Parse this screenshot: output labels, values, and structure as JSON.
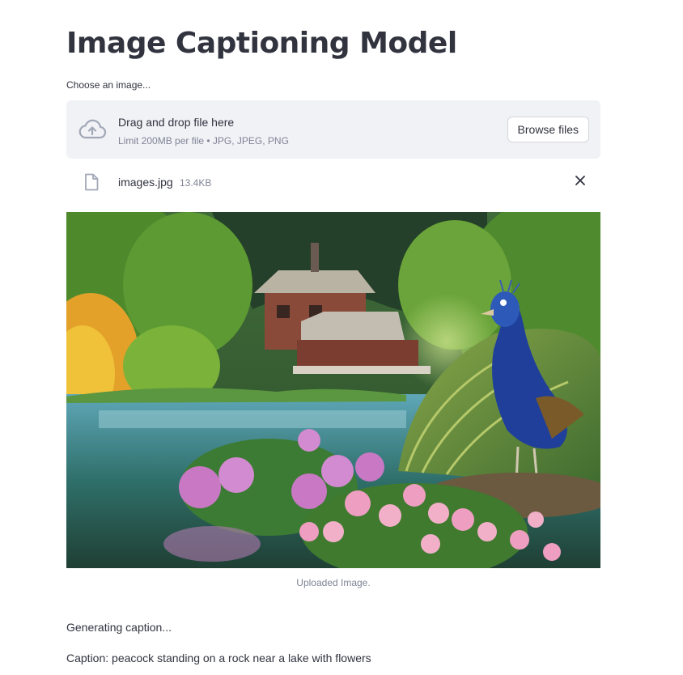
{
  "page": {
    "title": "Image Captioning Model"
  },
  "uploader": {
    "label": "Choose an image...",
    "instructions": "Drag and drop file here",
    "limit": "Limit 200MB per file • JPG, JPEG, PNG",
    "browse_label": "Browse files",
    "cloud_icon": "cloud-upload-icon"
  },
  "uploaded_file": {
    "name": "images.jpg",
    "size": "13.4KB",
    "file_icon": "file-icon",
    "remove_icon": "close-icon"
  },
  "image": {
    "caption": "Uploaded Image."
  },
  "output": {
    "status": "Generating caption...",
    "caption": "Caption: peacock standing on a rock near a lake with flowers"
  },
  "colors": {
    "text": "#31333f",
    "muted": "#808495",
    "dropzone_bg": "#f0f2f6"
  }
}
